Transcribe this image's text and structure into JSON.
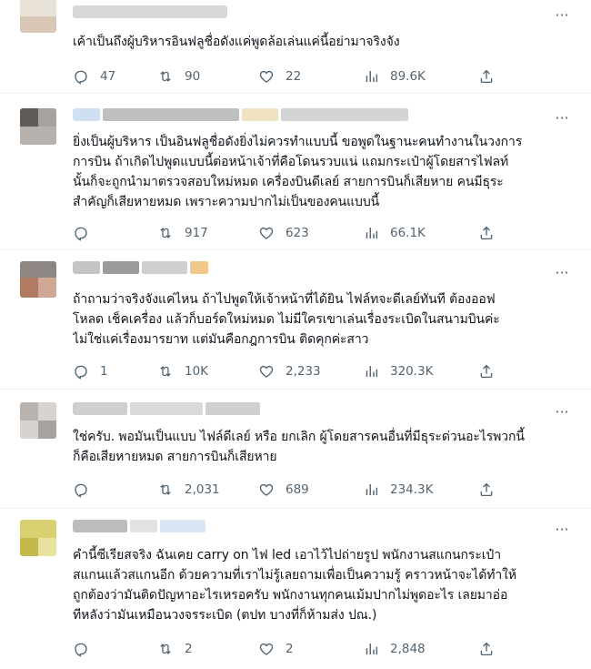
{
  "tweets": [
    {
      "lines": [
        "เค้าเป็นถึงผู้บริหารอินฟลูชื่อดังแค่พูดล้อเล่นแค่นี้อย่ามาจริงจัง"
      ],
      "replies": "47",
      "retweets": "90",
      "likes": "22",
      "views": "89.6K"
    },
    {
      "lines": [
        "ยิ่งเป็นผู้บริหาร เป็นอินฟลูชื่อดังยิ่งไม่ควรทำแบบนี้ ขอพูดในฐานะคนทำงานในวงการ",
        "การบิน ถ้าเกิดไปพูดแบบนี้ต่อหน้าเจ้าที่คือโดนรวบแน่ แถมกระเป๋าผู้โดยสารไฟลท์",
        "นั้นก็จะถูกนำมาตรวจสอบใหม่หมด เครื่องบินดีเลย์ สายการบินก็เสียหาย คนมีธุระ",
        "สำคัญก็เสียหายหมด เพราะความปากไม่เป็นของคนแบบนี้"
      ],
      "replies": "",
      "retweets": "917",
      "likes": "623",
      "views": "66.1K"
    },
    {
      "lines": [
        "ถ้าถามว่าจริงจังแค่ไหน ถ้าไปพูดให้เจ้าหน้าที่ได้ยิน ไฟล์ทจะดีเลย์ทันที ต้องออฟ",
        "โหลด เช็คเครื่อง แล้วก็บอร์ดใหม่หมด ไม่มีใครเขาเล่นเรื่องระเบิดในสนามบินค่ะ",
        "ไม่ใช่แค่เรื่องมารยาท แต่มันคือกฎการบิน ติดคุกค่ะสาว"
      ],
      "replies": "1",
      "retweets": "10K",
      "likes": "2,233",
      "views": "320.3K"
    },
    {
      "lines": [
        "ใช่ครับ. พอมันเป็นแบบ ไฟล์ดีเลย์ หรือ ยกเลิก ผู้โดยสารคนอื่นที่มีธุระด่วนอะไรพวกนี้",
        "ก็คือเสียหายหมด สายการบินก็เสียหาย"
      ],
      "replies": "",
      "retweets": "2,031",
      "likes": "689",
      "views": "234.3K"
    },
    {
      "lines": [
        "คำนี้ซีเรียสจริง ฉันเคย carry on ไฟ led เอาไว้ไปถ่ายรูป พนักงานสแกนกระเป๋า",
        "สแกนแล้วสแกนอีก ด้วยความที่เราไม่รู้เลยถามเพื่อเป็นความรู้ คราวหน้าจะได้ทำให้",
        "ถูกต้องว่ามันติดปัญหาอะไรเหรอครับ พนักงานทุกคนเม้มปากไม่พูดอะไร เลยมาอ่อ",
        "ทีหลังว่ามันเหมือนวงจรระเบิด (ตปท บางที่ก็ห้ามส่ง ปณ.)"
      ],
      "replies": "",
      "retweets": "2",
      "likes": "2",
      "views": "2,848"
    }
  ],
  "icons": {
    "reply": "reply-icon",
    "retweet": "retweet-icon",
    "like": "heart-icon",
    "views": "views-icon",
    "share": "share-icon",
    "more": "more-icon"
  },
  "more_glyph": "···"
}
